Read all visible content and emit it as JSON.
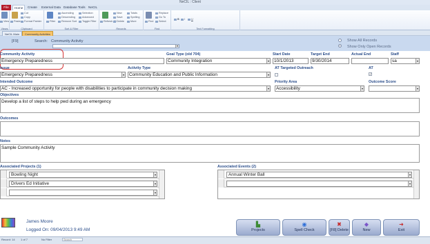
{
  "app": {
    "title": "NeCIL : Client"
  },
  "ribbon": {
    "file_tab": "File",
    "tabs": [
      "Home",
      "Create",
      "External Data",
      "Database Tools",
      "NeCIL"
    ],
    "groups": [
      {
        "label": "Views",
        "big": "View",
        "small": []
      },
      {
        "label": "Clipboard",
        "big": "Paste",
        "small": [
          "Cut",
          "Copy",
          "Format Painter"
        ]
      },
      {
        "label": "Sort & Filter",
        "big": "Filter",
        "small": [
          "Ascending",
          "Descending",
          "Remove Sort",
          "Selection",
          "Advanced",
          "Toggle Filter"
        ]
      },
      {
        "label": "Records",
        "big": "Refresh All",
        "small": [
          "New",
          "Save",
          "Delete",
          "Totals",
          "Spelling",
          "More"
        ]
      },
      {
        "label": "Find",
        "big": "Find",
        "small": [
          "Replace",
          "Go To",
          "Select"
        ]
      },
      {
        "label": "Text Formatting",
        "big": "",
        "small": [
          "B",
          "I",
          "U"
        ]
      }
    ]
  },
  "doc_tabs": [
    {
      "label": "NeCIL Main"
    },
    {
      "label": "Community Activities"
    }
  ],
  "search": {
    "f9": "[F9]",
    "label": "Search:",
    "value": "Community Activity",
    "show_all": "Show All Records",
    "show_open": "Show Only Open Records"
  },
  "form": {
    "community_activity": {
      "label": "Community Activity",
      "value": "Emergency Preparedness"
    },
    "goal_type": {
      "label": "Goal Type (old 704)",
      "value": "Community Integration"
    },
    "start_date": {
      "label": "Start Date",
      "value": "10/1/2013"
    },
    "target_end": {
      "label": "Target End",
      "value": "9/30/2014"
    },
    "actual_end": {
      "label": "Actual End",
      "value": ""
    },
    "staff": {
      "label": "Staff",
      "value": "sa"
    },
    "issue": {
      "label": "Issue",
      "value": "Emergency Preparedness"
    },
    "activity_type": {
      "label": "Activity Type",
      "value": "Community Education and Public Information"
    },
    "at_targeted_outreach": {
      "label": "AT Targeted Outreach"
    },
    "at": {
      "label": "AT"
    },
    "intended_outcome": {
      "label": "Intended Outcome",
      "value": "AC - Increased opportunity for people with disabilities to participate in community decision making"
    },
    "priority_area": {
      "label": "Priority Area",
      "value": "Accessibility"
    },
    "outcome_score": {
      "label": "Outcome Score",
      "value": ""
    },
    "objectives": {
      "label": "Objectives",
      "value": "Develop a list of steps to help pwd during an emergency"
    },
    "outcomes": {
      "label": "Outcomes",
      "value": ""
    },
    "notes": {
      "label": "Notes",
      "value": "Sample Community Activity"
    }
  },
  "associated_projects": {
    "label": "Associated Projects (1)",
    "rows": [
      "Bowling Night",
      "Drivers Ed Initiative",
      ""
    ]
  },
  "associated_events": {
    "label": "Associated Events (2)",
    "rows": [
      "Annual Winter Ball",
      ""
    ]
  },
  "user": {
    "name": "James Moore",
    "logged_on": "Logged On: 09/04/2013 9:49 AM"
  },
  "footer_buttons": [
    {
      "label": "Projects",
      "icon": "projects-icon",
      "glyph": "▙",
      "color": "#3c8a35"
    },
    {
      "label": "Spell Check",
      "icon": "spell-check-icon",
      "glyph": "◉",
      "color": "#2e6fd8"
    },
    {
      "label": "[F8] Delete",
      "icon": "delete-icon",
      "glyph": "✖",
      "color": "#c62828"
    },
    {
      "label": "New",
      "icon": "new-icon",
      "glyph": "◆",
      "color": "#7b56c9"
    },
    {
      "label": "Exit",
      "icon": "exit-icon",
      "glyph": "➜",
      "color": "#c62828"
    }
  ],
  "record_nav": {
    "record_label": "Record: 14",
    "position": "1 of 7",
    "filter": "No Filter",
    "search_placeholder": "Search"
  }
}
